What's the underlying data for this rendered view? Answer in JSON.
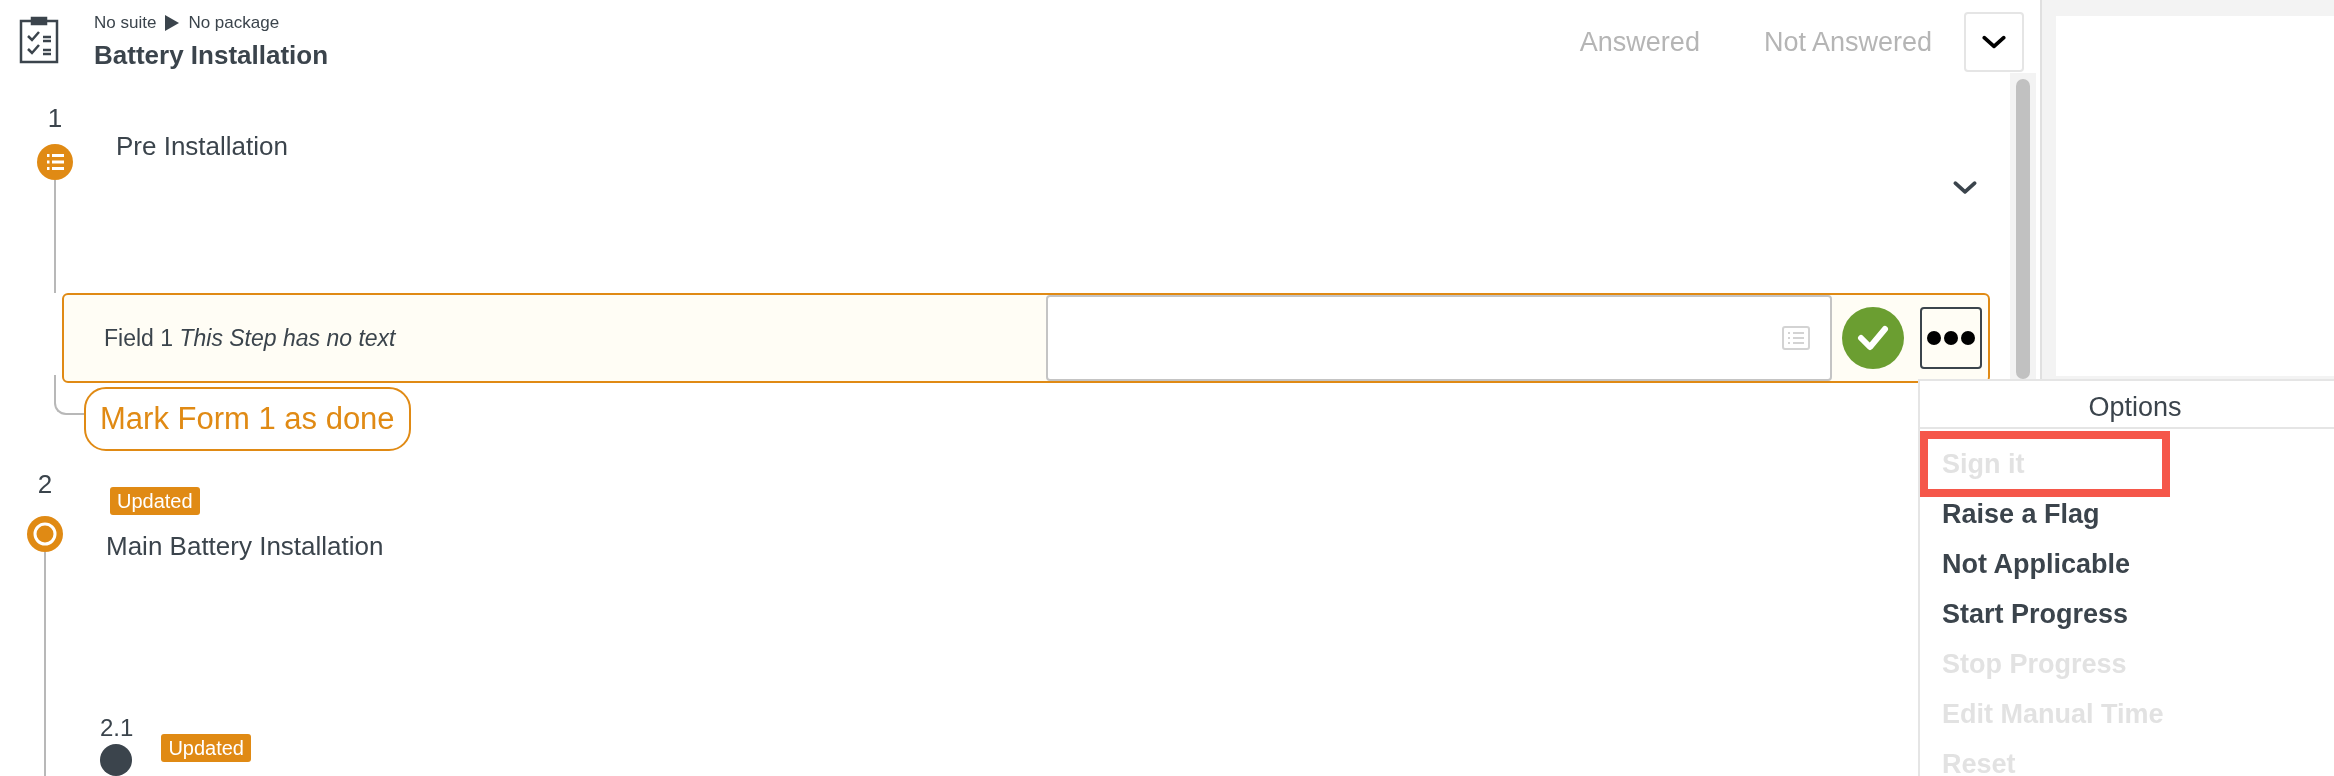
{
  "header": {
    "breadcrumb": [
      "No suite",
      "No package"
    ],
    "title": "Battery Installation",
    "filters": [
      "Answered",
      "Not Answered"
    ]
  },
  "steps": [
    {
      "number": "1",
      "kind": "list",
      "title": "Pre Installation",
      "field": "Field 1 *This Step has no text*",
      "action": "Mark Form 1 as done"
    },
    {
      "number": "2",
      "kind": "ring",
      "badge": "Updated",
      "title": "Main Battery Installation",
      "children": [
        {
          "number": "2.1",
          "kind": "dark",
          "badge": "Updated"
        }
      ]
    }
  ],
  "menu": {
    "title": "Options",
    "items": [
      {
        "label": "Sign it",
        "disabled": true,
        "highlighted": true
      },
      {
        "label": "Raise a Flag",
        "disabled": false,
        "highlighted": false
      },
      {
        "label": "Not Applicable",
        "disabled": false,
        "highlighted": false
      },
      {
        "label": "Start Progress",
        "disabled": false,
        "highlighted": false
      },
      {
        "label": "Stop Progress",
        "disabled": true,
        "highlighted": false
      },
      {
        "label": "Edit Manual Time",
        "disabled": true,
        "highlighted": false
      },
      {
        "label": "Reset",
        "disabled": true,
        "highlighted": false
      }
    ]
  }
}
